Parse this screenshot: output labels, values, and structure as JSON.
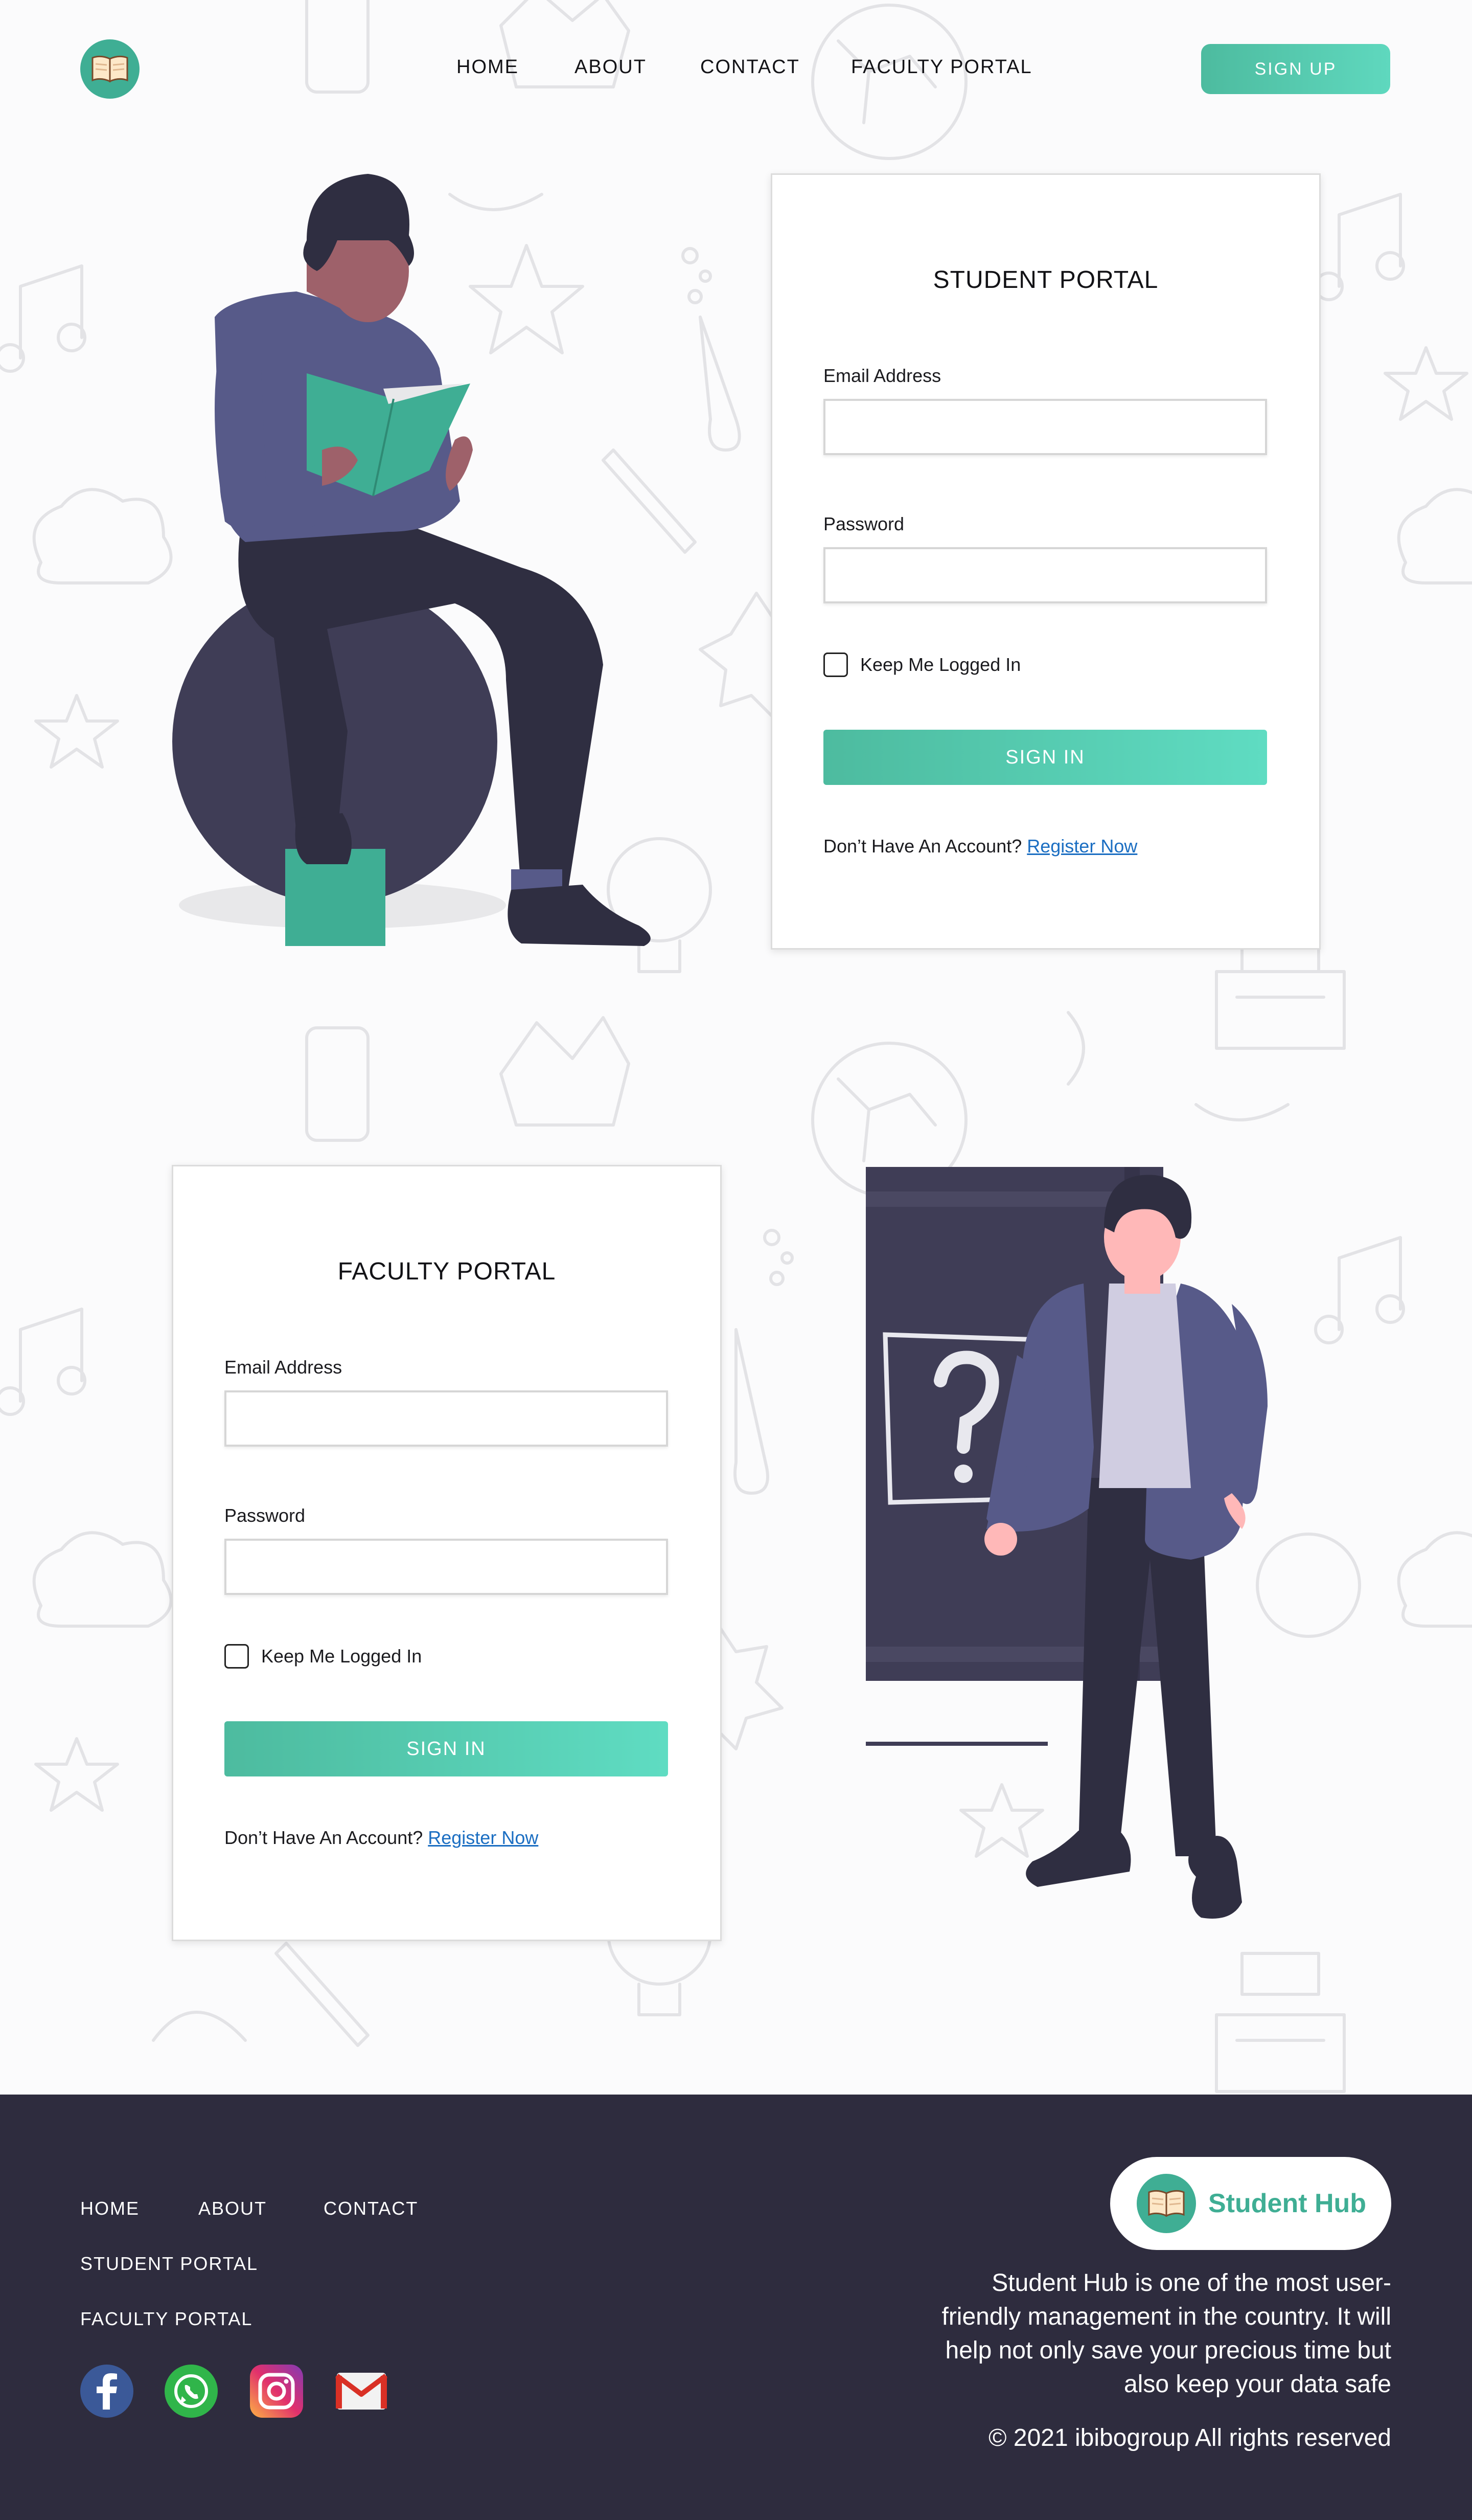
{
  "colors": {
    "accent": "#3fae94",
    "accent_gradient_start": "#4dbb9f",
    "accent_gradient_end": "#5fd8be",
    "footer_bg": "#2e2c3e",
    "link": "#1b6ec2",
    "illustration_dark": "#3f3d56",
    "illustration_purple": "#575a89"
  },
  "header": {
    "logo_icon": "open-book-icon",
    "nav": [
      "HOME",
      "ABOUT",
      "CONTACT",
      "FACULTY PORTAL"
    ],
    "signup_label": "SIGN UP"
  },
  "student_portal": {
    "title": "STUDENT PORTAL",
    "email_label": "Email Address",
    "email_value": "",
    "password_label": "Password",
    "password_value": "",
    "remember_label": "Keep Me Logged In",
    "remember_checked": false,
    "signin_label": "SIGN IN",
    "register_prompt": "Don’t Have An Account?",
    "register_link": "Register Now"
  },
  "faculty_portal": {
    "title": "FACULTY PORTAL",
    "email_label": "Email Address",
    "email_value": "",
    "password_label": "Password",
    "password_value": "",
    "remember_label": "Keep Me Logged In",
    "remember_checked": false,
    "signin_label": "SIGN IN",
    "register_prompt": "Don’t Have An Account?",
    "register_link": "Register Now"
  },
  "footer": {
    "links": [
      "HOME",
      "ABOUT",
      "CONTACT",
      "STUDENT PORTAL",
      "FACULTY PORTAL"
    ],
    "social_icons": [
      "facebook-icon",
      "whatsapp-icon",
      "instagram-icon",
      "gmail-icon"
    ],
    "brand_name": "Student Hub",
    "description": "Student Hub is one of the most user-friendly management in the country. It will help not only save your precious time but also keep your data safe",
    "copyright": "© 2021 ibibogroup All rights reserved"
  }
}
